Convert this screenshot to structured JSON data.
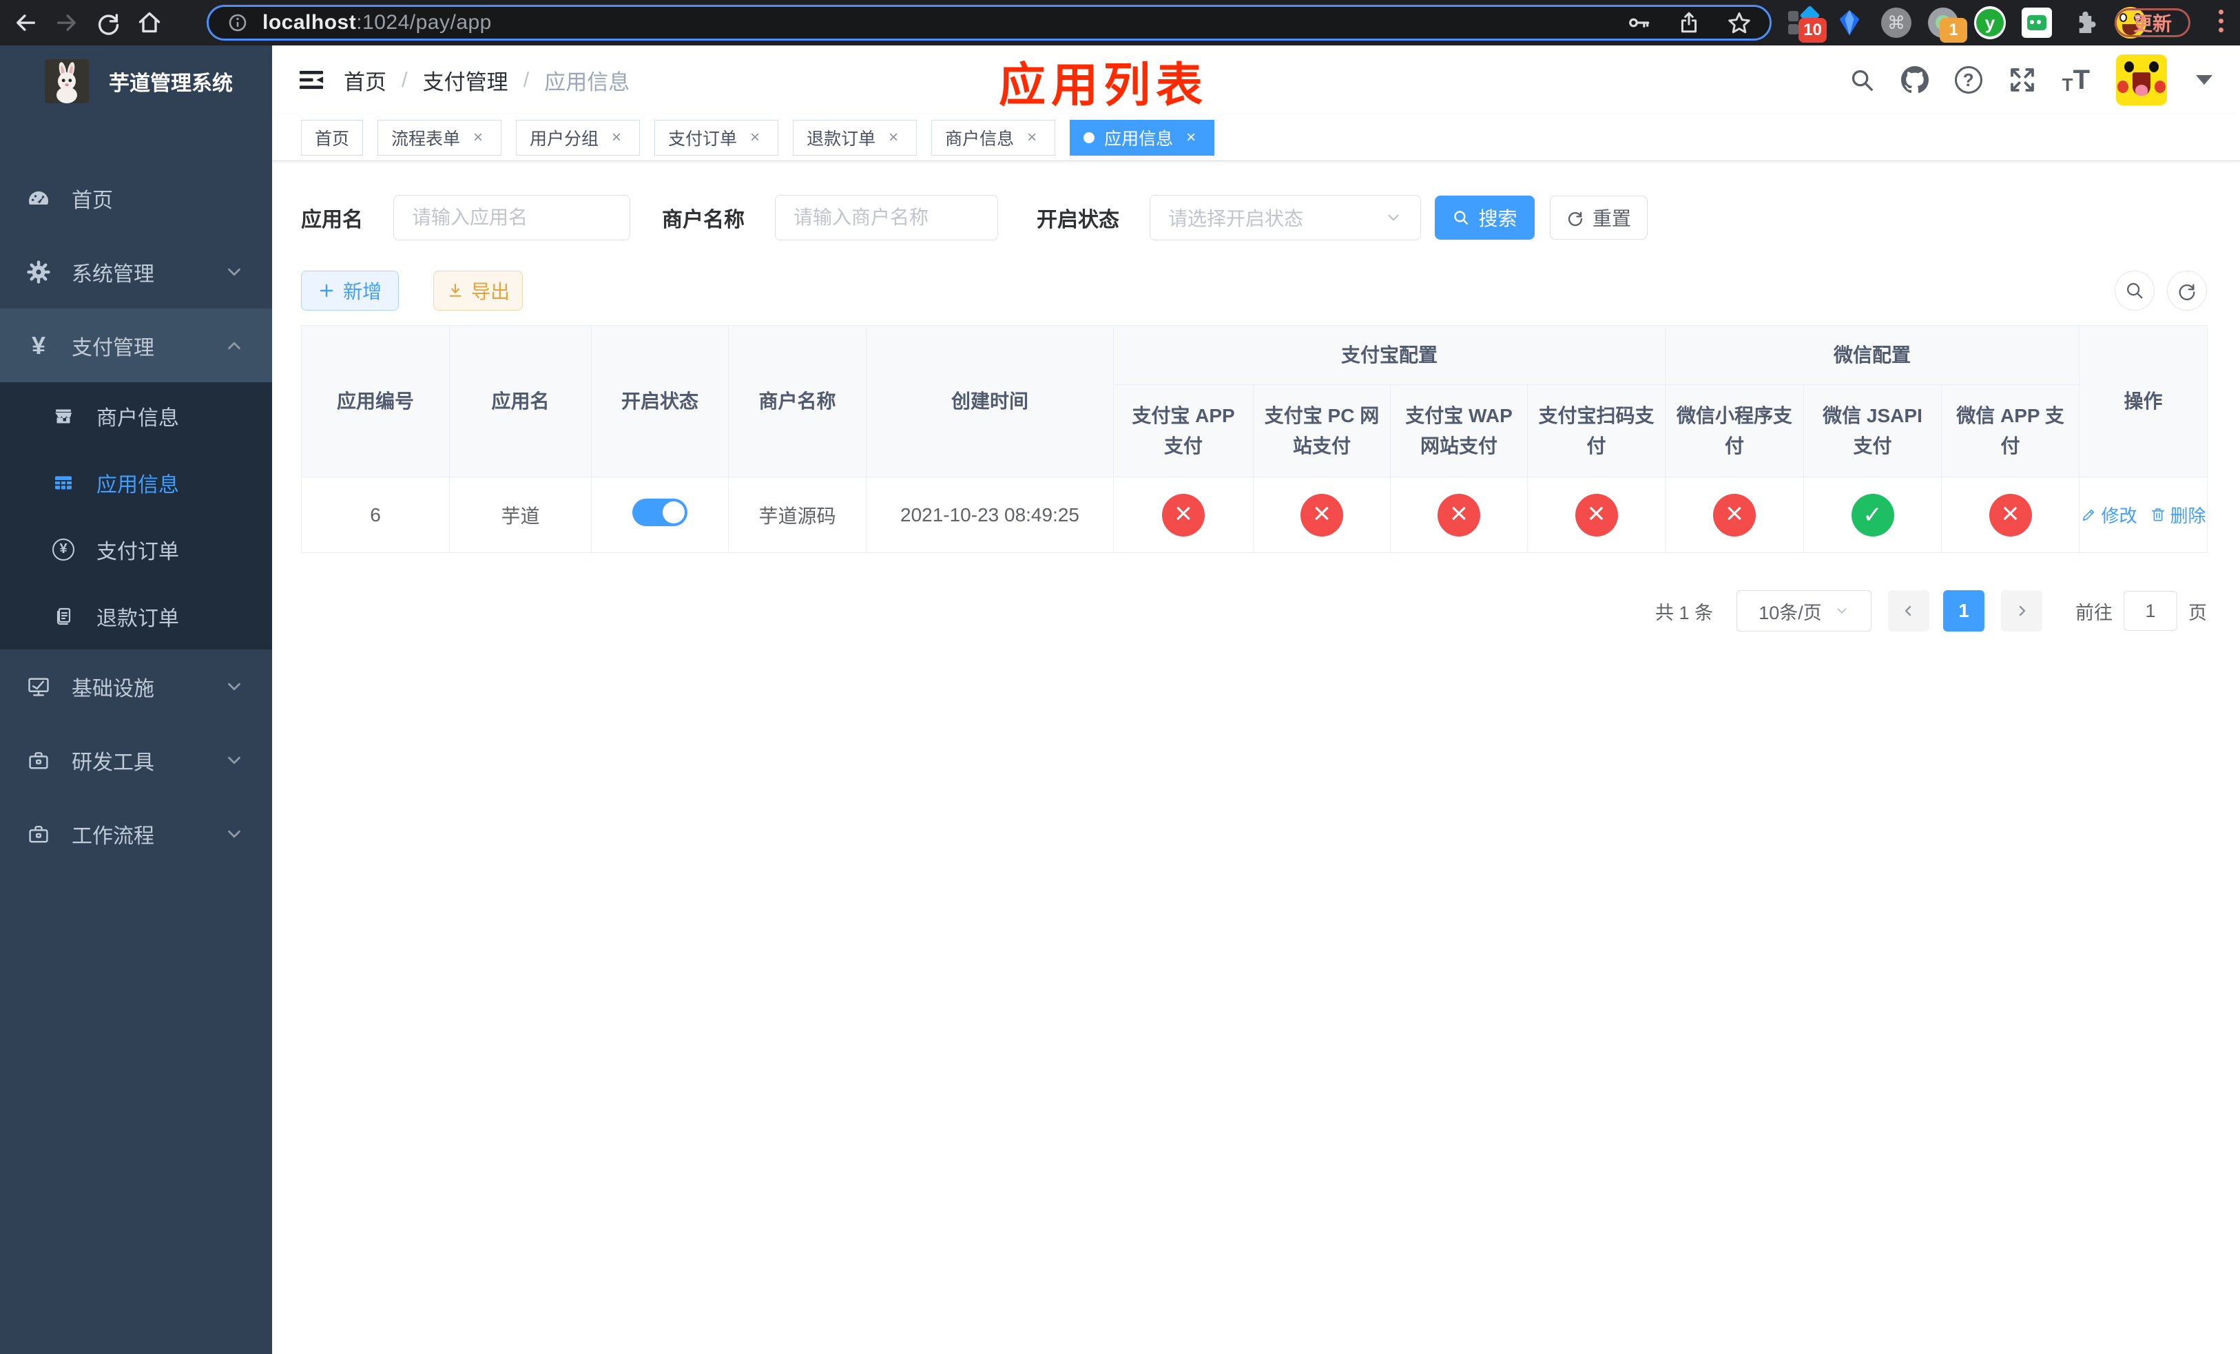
{
  "browser": {
    "url_host": "localhost",
    "url_path": ":1024/pay/app",
    "update_label": "更新",
    "badges": {
      "extension_a": "10",
      "extension_b": "1"
    },
    "ext_y_label": "y"
  },
  "annotation": {
    "title": "应用列表"
  },
  "sidebar": {
    "title": "芋道管理系统",
    "items": {
      "home": "首页",
      "system": "系统管理",
      "pay": "支付管理",
      "merchant": "商户信息",
      "app": "应用信息",
      "order": "支付订单",
      "refund": "退款订单",
      "infra": "基础设施",
      "devtools": "研发工具",
      "workflow": "工作流程"
    }
  },
  "navbar": {
    "breadcrumb": {
      "level1": "首页",
      "level2": "支付管理",
      "level3": "应用信息"
    },
    "help_glyph": "?"
  },
  "tabs": {
    "t0": "首页",
    "t1": "流程表单",
    "t2": "用户分组",
    "t3": "支付订单",
    "t4": "退款订单",
    "t5": "商户信息",
    "t6": "应用信息"
  },
  "filters": {
    "app_name_label": "应用名",
    "app_name_placeholder": "请输入应用名",
    "merchant_label": "商户名称",
    "merchant_placeholder": "请输入商户名称",
    "status_label": "开启状态",
    "status_placeholder": "请选择开启状态",
    "search_label": "搜索",
    "reset_label": "重置"
  },
  "toolbar": {
    "add_label": "新增",
    "export_label": "导出"
  },
  "table": {
    "columns": {
      "id": "应用编号",
      "name": "应用名",
      "status": "开启状态",
      "merchant": "商户名称",
      "created": "创建时间",
      "group_alipay": "支付宝配置",
      "group_wechat": "微信配置",
      "alipay_app": "支付宝 APP 支付",
      "alipay_pc": "支付宝 PC 网站支付",
      "alipay_wap": "支付宝 WAP 网站支付",
      "alipay_qr": "支付宝扫码支付",
      "wechat_mini": "微信小程序支付",
      "wechat_jsapi": "微信 JSAPI 支付",
      "wechat_app": "微信 APP 支付",
      "ops": "操作"
    },
    "row": {
      "id": "6",
      "name": "芋道",
      "enabled": "true",
      "merchant": "芋道源码",
      "created": "2021-10-23 08:49:25",
      "alipay_app": "fail",
      "alipay_pc": "fail",
      "alipay_wap": "fail",
      "alipay_qr": "fail",
      "wechat_mini": "fail",
      "wechat_jsapi": "success",
      "wechat_app": "fail",
      "edit_label": "修改",
      "delete_label": "删除"
    }
  },
  "pagination": {
    "total": "共 1 条",
    "page_size": "10条/页",
    "page": "1",
    "goto_label": "前往",
    "goto_value": "1",
    "unit_label": "页"
  },
  "colors": {
    "accent": "#409eff",
    "success": "#1dbf62",
    "danger": "#f44b4b",
    "annotation": "#ff2b00"
  }
}
